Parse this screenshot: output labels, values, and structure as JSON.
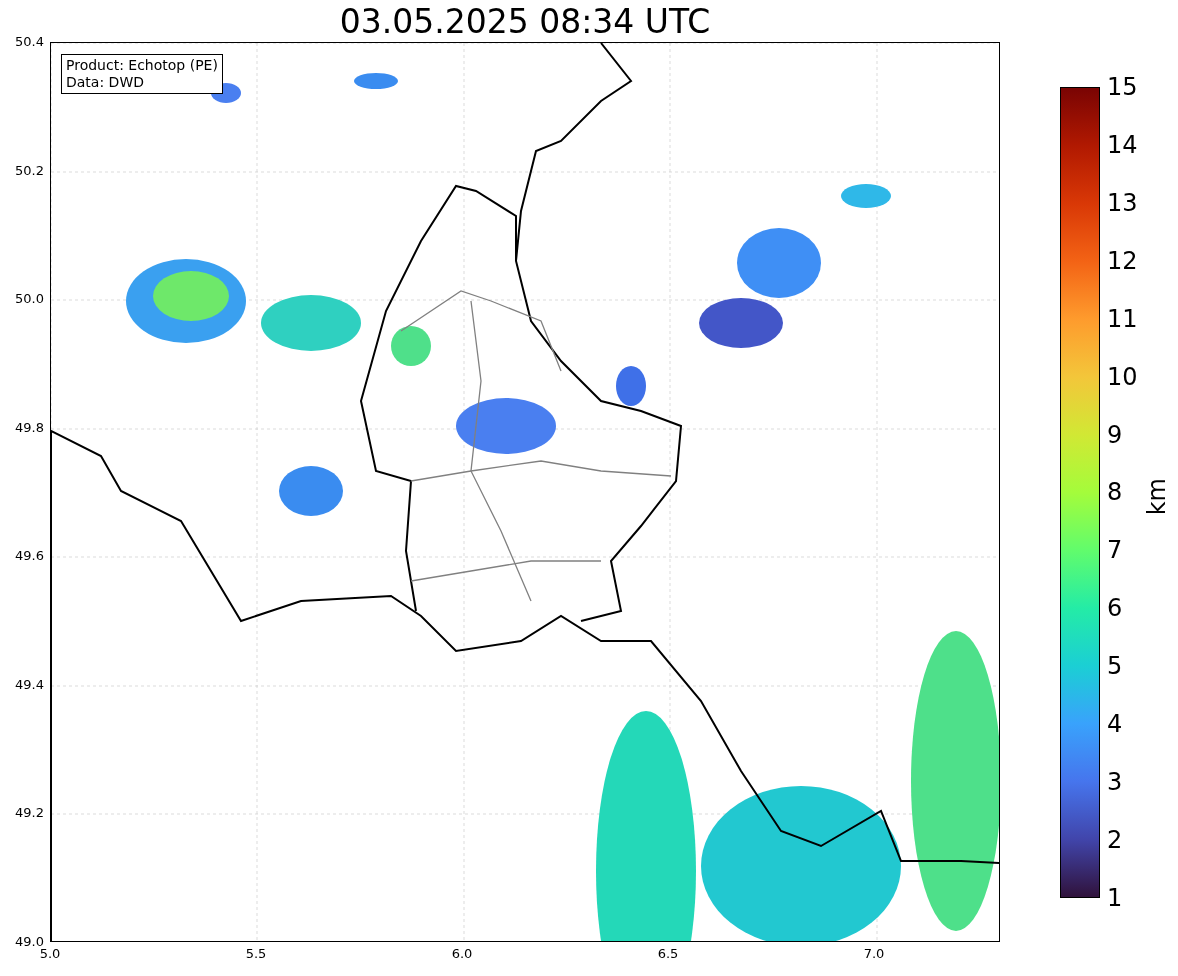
{
  "title": "03.05.2025 08:34 UTC",
  "legend": {
    "lines": [
      "Product: Echotop (PE)",
      "Data: DWD"
    ]
  },
  "x_ticks": [
    "5.0",
    "5.5",
    "6.0",
    "6.5",
    "7.0"
  ],
  "y_ticks": [
    "50.4",
    "50.2",
    "50.0",
    "49.8",
    "49.6",
    "49.4",
    "49.2",
    "49.0"
  ],
  "colorbar": {
    "ticks": [
      "15",
      "14",
      "13",
      "12",
      "11",
      "10",
      "9",
      "8",
      "7",
      "6",
      "5",
      "4",
      "3",
      "2",
      "1"
    ],
    "label": "km"
  }
}
